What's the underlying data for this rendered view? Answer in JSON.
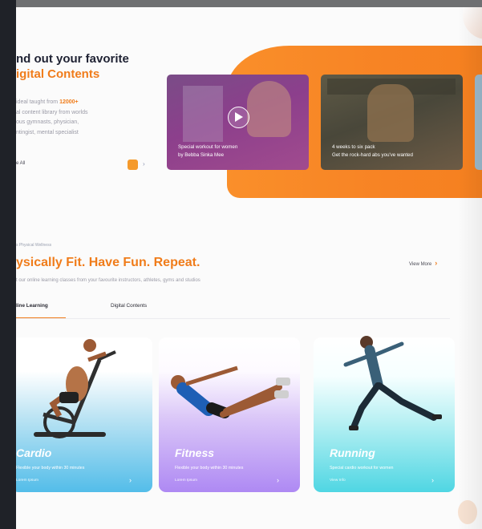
{
  "hero": {
    "title_line1": "nd out your favorite",
    "title_line2": "igital Contents",
    "desc_prefix": "ideal taught from ",
    "desc_highlight": "12000+",
    "desc_line2": "al content library from worlds",
    "desc_line3": "ous gymnasts, physician,",
    "desc_line4": "ntingist, mental specialist",
    "see_all": "e All",
    "next_arrow": "›"
  },
  "cards": [
    {
      "caption1": "Special workout for women",
      "caption2": "by Bebba Sinka Mee"
    },
    {
      "caption1": "4 weeks to six pack",
      "caption2": "Get the rock-hard abs you've wanted"
    }
  ],
  "section": {
    "kicker": "s Physical Wellness",
    "title": "ysically Fit. Have Fun. Repeat.",
    "subtitle": "t our online learning classes from your favourite instructors, athletes, gyms and studios",
    "view_more": "View More",
    "view_more_chev": "›",
    "tabs": [
      "line Learning",
      "Digital Contents"
    ]
  },
  "categories": [
    {
      "name": "Cardio",
      "desc": "Flexible your body within 30 minutes",
      "link": "Lorem Ipsum",
      "chev": "›"
    },
    {
      "name": "Fitness",
      "desc": "Flexible your body within 30 minutes",
      "link": "Lorem Ipsum",
      "chev": "›"
    },
    {
      "name": "Running",
      "desc": "Special cardio workout for women",
      "link": "View Info",
      "chev": "›"
    }
  ],
  "colors": {
    "accent": "#f07c1a",
    "cardio": "#53bde9",
    "fitness": "#ae89f3",
    "running": "#4fd6e3"
  },
  "icons": [
    "play-icon",
    "chevron-right-icon"
  ]
}
